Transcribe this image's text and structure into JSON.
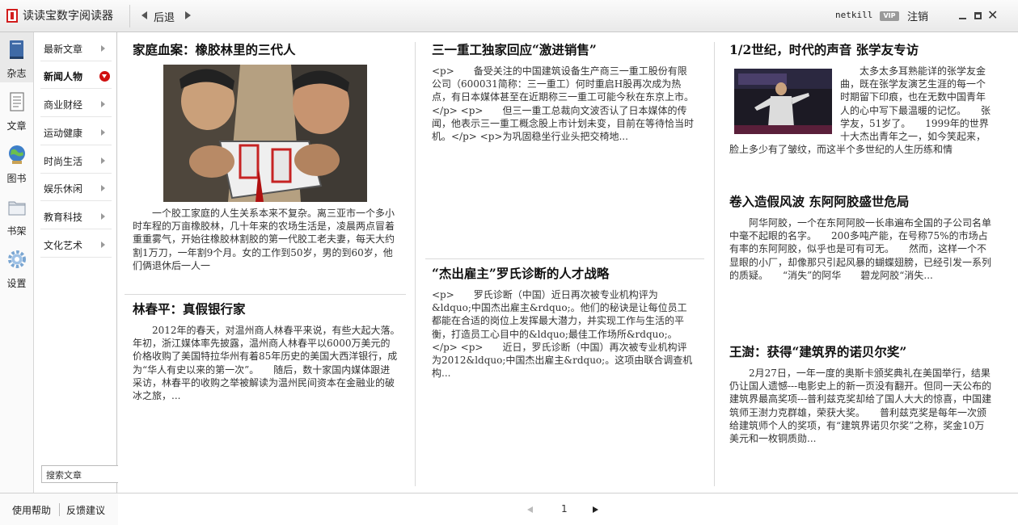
{
  "app": {
    "title": "读读宝数字阅读器",
    "back_label": "后退",
    "username": "netkill",
    "vip_badge": "VIP",
    "logout_label": "注销"
  },
  "rail": {
    "items": [
      {
        "label": "杂志",
        "icon": "magazine-icon",
        "active": true
      },
      {
        "label": "文章",
        "icon": "article-icon",
        "active": false
      },
      {
        "label": "图书",
        "icon": "globe-book-icon",
        "active": false
      },
      {
        "label": "书架",
        "icon": "folder-shelf-icon",
        "active": false
      },
      {
        "label": "设置",
        "icon": "gear-icon",
        "active": false
      }
    ]
  },
  "categories": {
    "items": [
      {
        "label": "最新文章",
        "active": false
      },
      {
        "label": "新闻人物",
        "active": true
      },
      {
        "label": "商业财经",
        "active": false
      },
      {
        "label": "运动健康",
        "active": false
      },
      {
        "label": "时尚生活",
        "active": false
      },
      {
        "label": "娱乐休闲",
        "active": false
      },
      {
        "label": "教育科技",
        "active": false
      },
      {
        "label": "文化艺术",
        "active": false
      }
    ]
  },
  "search": {
    "placeholder": "搜索文章"
  },
  "footer_links": {
    "help": "使用帮助",
    "feedback": "反馈建议"
  },
  "articles": [
    {
      "title": "家庭血案：橡胶林里的三代人",
      "has_image": true,
      "body": "一个胶工家庭的人生关系本来不复杂。离三亚市一个多小时车程的万亩橡胶林，几十年来的农场生活是，凌晨两点冒着重重雾气，开始往橡胶林割胶的第一代胶工老夫妻，每天大约割1万刀，一年割9个月。女的工作到50岁，男的到60岁，他们俩退休后一人一"
    },
    {
      "title": "林春平：真假银行家",
      "body": "2012年的春天，对温州商人林春平来说，有些大起大落。　　年初，浙江媒体率先披露，温州商人林春平以6000万美元的价格收购了美国特拉华州有着85年历史的美国大西洋银行，成为“华人有史以来的第一次”。　　随后，数十家国内媒体跟进采访，林春平的收购之举被解读为温州民间资本在金融业的破冰之旅，..."
    },
    {
      "title": "三一重工独家回应“激进销售”",
      "body": "<p>　　备受关注的中国建筑设备生产商三一重工股份有限公司（600031简称：三一重工）何时重启H股再次成为热点，有日本媒体甚至在近期称三一重工可能今秋在东京上市。</p> <p>　　但三一重工总裁向文波否认了日本媒体的传闻，他表示三一重工概念股上市计划未变，目前在等待恰当时机。</p> <p>为巩固稳坐行业头把交椅地..."
    },
    {
      "title": "“杰出雇主”罗氏诊断的人才战略",
      "body": "<p>　　罗氏诊断（中国）近日再次被专业机构评为&ldquo;中国杰出雇主&rdquo;。他们的秘诀是让每位员工都能在合适的岗位上发挥最大潜力，并实现工作与生活的平衡，打造员工心目中的&ldquo;最佳工作场所&rdquo;。</p> <p>　　近日，罗氏诊断（中国）再次被专业机构评为2012&ldquo;中国杰出雇主&rdquo;。这项由联合调查机构..."
    },
    {
      "title": "1/2世纪，时代的声音 张学友专访",
      "has_image": true,
      "body": "太多太多耳熟能详的张学友金曲，既在张学友演艺生涯的每一个时期留下印痕，也在无数中国青年人的心中写下最温暖的记忆。　　张学友，51岁了。　　1999年的世界十大杰出青年之一，如今笑起来，脸上多少有了皱纹，而这半个多世纪的人生历练和情"
    },
    {
      "title": "卷入造假风波 东阿阿胶盛世危局",
      "body": "阿华阿胶，一个在东阿阿胶一长串遍布全国的子公司名单中毫不起眼的名字。　　200多吨产能，在号称75%的市场占有率的东阿阿胶，似乎也是可有可无。　　然而，这样一个不显眼的小厂，却像那只引起风暴的蝴蝶翅膀，已经引发一系列的质疑。　　“消失”的阿华　　碧龙阿胶“消失..."
    },
    {
      "title": "王澍：获得“建筑界的诺贝尔奖”",
      "body": "2月27日，一年一度的奥斯卡颁奖典礼在美国举行，结果仍让国人遗憾---电影史上的新一页没有翻开。但同一天公布的建筑界最高奖项---普利兹克奖却给了国人大大的惊喜，中国建筑师王澍力克群雄，荣获大奖。　　普利兹克奖是每年一次颁给建筑师个人的奖项，有“建筑界诺贝尔奖”之称，奖金10万美元和一枚铜质勋..."
    }
  ],
  "pager": {
    "current_page": "1"
  }
}
